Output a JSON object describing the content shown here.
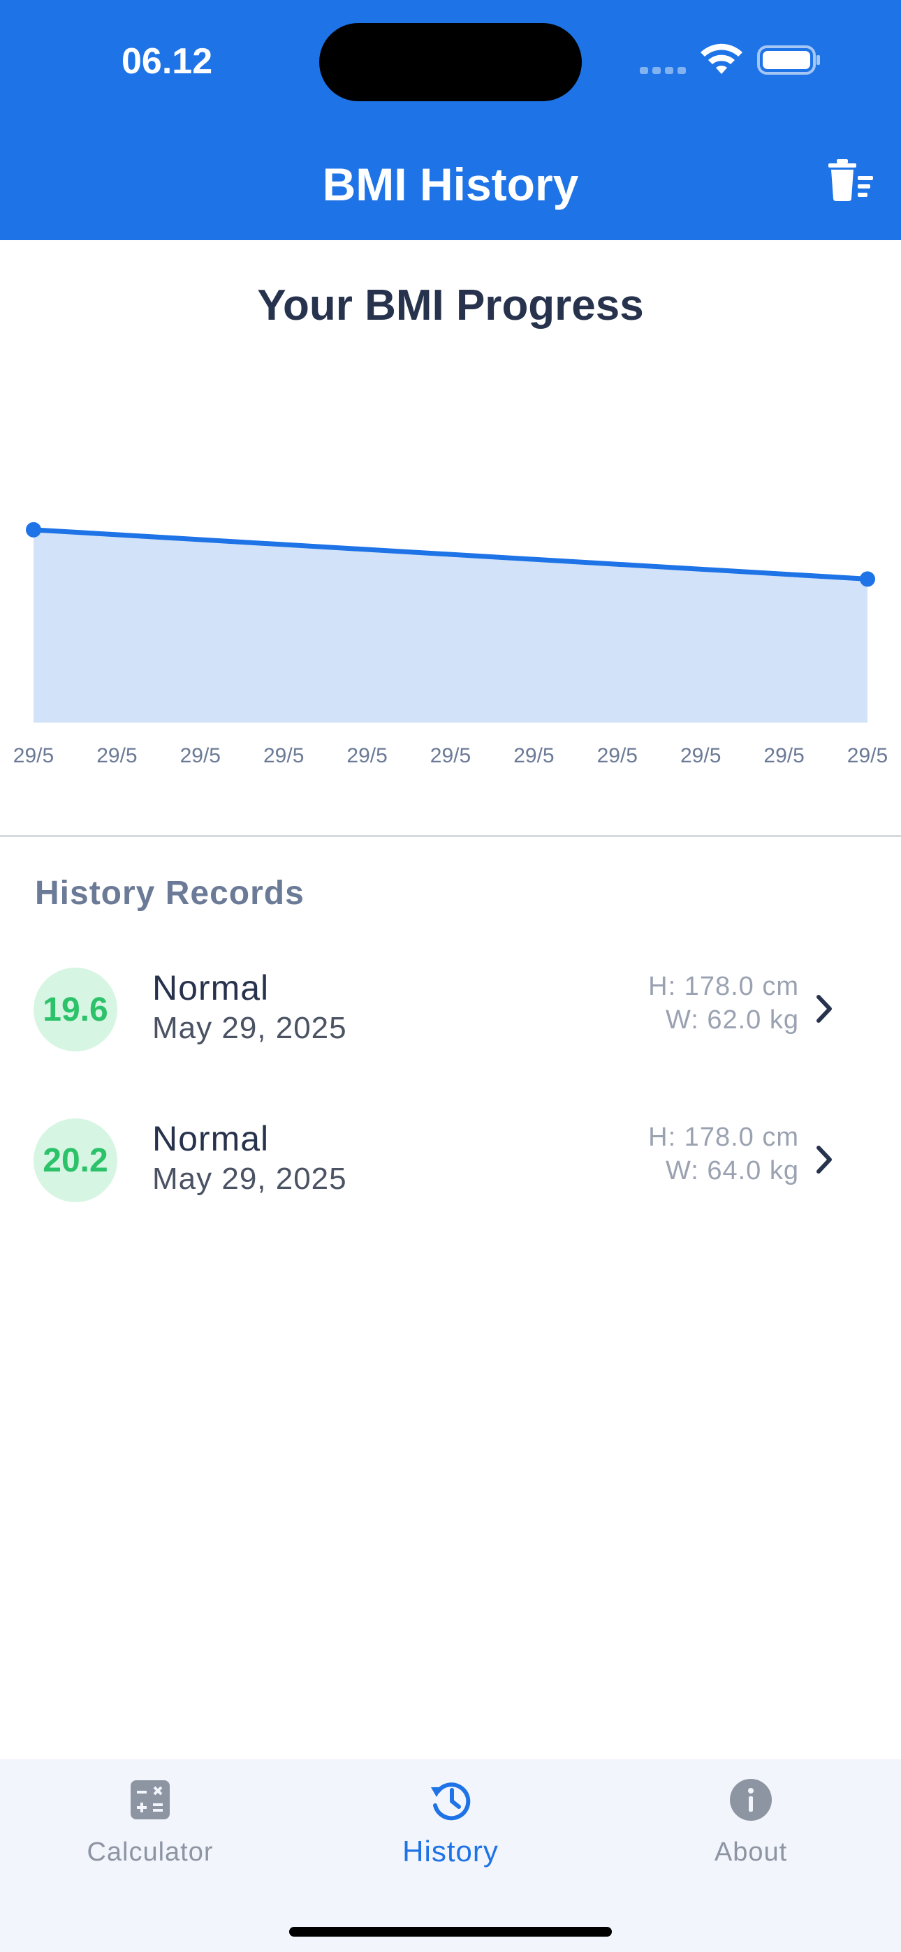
{
  "status_bar": {
    "time": "06.12"
  },
  "header": {
    "title": "BMI History",
    "trash_icon": "trash-list-icon"
  },
  "chart": {
    "title": "Your BMI Progress"
  },
  "chart_data": {
    "type": "area",
    "x": [
      "29/5",
      "29/5",
      "29/5",
      "29/5",
      "29/5",
      "29/5",
      "29/5",
      "29/5",
      "29/5",
      "29/5",
      "29/5"
    ],
    "points": [
      {
        "x_index": 0,
        "y": 20.2
      },
      {
        "x_index": 10,
        "y": 19.6
      }
    ],
    "title": "",
    "xlabel": "",
    "ylabel": "",
    "line_color": "#1e73e6",
    "fill_color": "#d2e3f9",
    "grid": false
  },
  "records": {
    "title": "History Records",
    "items": [
      {
        "bmi": "19.6",
        "category": "Normal",
        "date": "May 29, 2025",
        "height": "H: 178.0 cm",
        "weight": "W: 62.0 kg"
      },
      {
        "bmi": "20.2",
        "category": "Normal",
        "date": "May 29, 2025",
        "height": "H: 178.0 cm",
        "weight": "W: 64.0 kg"
      }
    ]
  },
  "tabs": [
    {
      "label": "Calculator",
      "icon": "calculator-icon",
      "active": false
    },
    {
      "label": "History",
      "icon": "history-icon",
      "active": true
    },
    {
      "label": "About",
      "icon": "info-icon",
      "active": false
    }
  ],
  "colors": {
    "primary": "#1e73e6",
    "normal_badge_bg": "#d7f5e3",
    "normal_badge_text": "#2bc26a",
    "inactive_tab": "#8d95a3"
  }
}
